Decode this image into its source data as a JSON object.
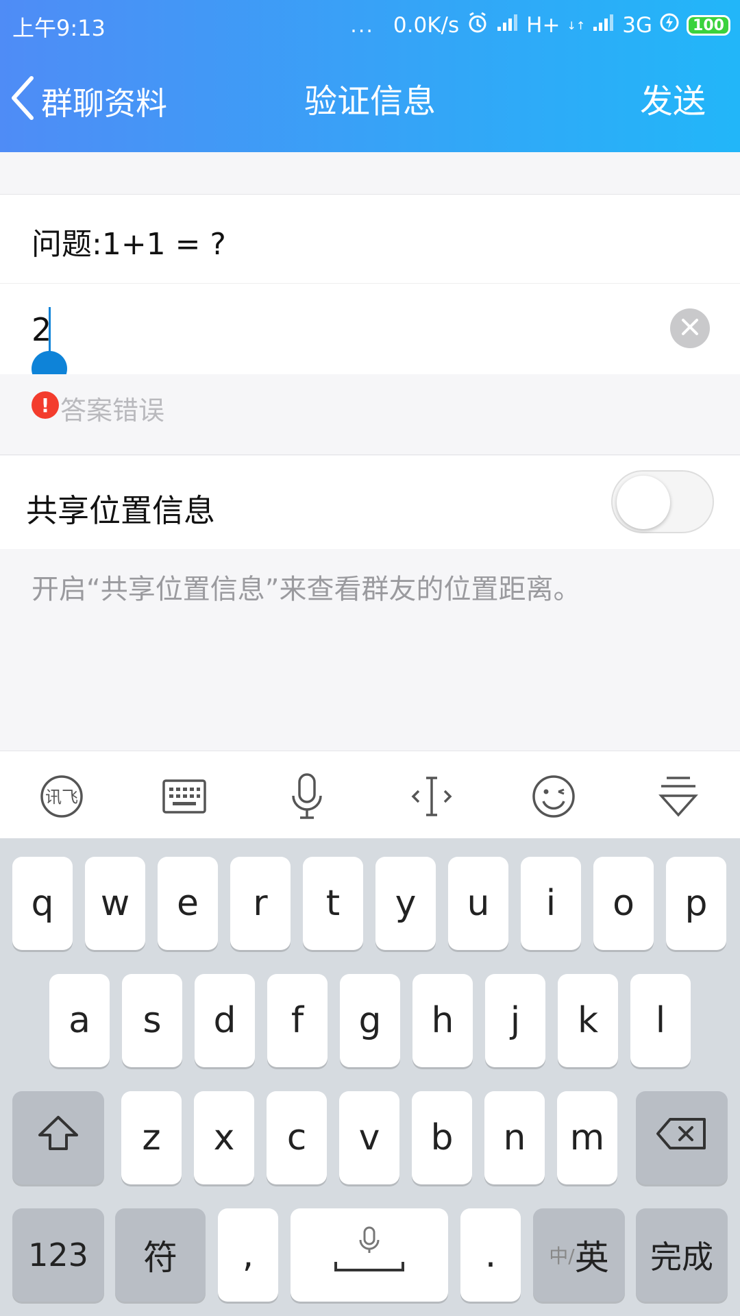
{
  "status_bar": {
    "time": "上午9:13",
    "dots": "...",
    "net_speed": "0.0K/s",
    "net_1": "H+",
    "net_1_sub": "↓↑",
    "net_2": "3G",
    "battery": "100"
  },
  "nav": {
    "back_label": "群聊资料",
    "title": "验证信息",
    "send_label": "发送"
  },
  "question": "问题:1+1 = ?",
  "answer": {
    "value": "2"
  },
  "error": {
    "icon_char": "!",
    "message": "答案错误"
  },
  "share_location": {
    "label": "共享位置信息",
    "enabled": false,
    "description": "开启“共享位置信息”来查看群友的位置距离。"
  },
  "ime_toolbar": {
    "icons": [
      "xunfei-logo-icon",
      "keyboard-icon",
      "microphone-icon",
      "cursor-move-icon",
      "emoji-icon",
      "collapse-keyboard-icon"
    ],
    "xunfei_label": "讯飞"
  },
  "keyboard": {
    "row1": [
      "q",
      "w",
      "e",
      "r",
      "t",
      "y",
      "u",
      "i",
      "o",
      "p"
    ],
    "row2": [
      "a",
      "s",
      "d",
      "f",
      "g",
      "h",
      "j",
      "k",
      "l"
    ],
    "row3": [
      "z",
      "x",
      "c",
      "v",
      "b",
      "n",
      "m"
    ],
    "num_label": "123",
    "symbol_label": "符",
    "comma_label": ",",
    "period_label": ".",
    "lang_small": "中/",
    "lang_big": "英",
    "done_label": "完成"
  },
  "colors": {
    "header_start": "#4f8cf6",
    "header_end": "#22b6f9",
    "caret": "#0e83d8",
    "error": "#f33c2d",
    "battery": "#3bd23d"
  }
}
